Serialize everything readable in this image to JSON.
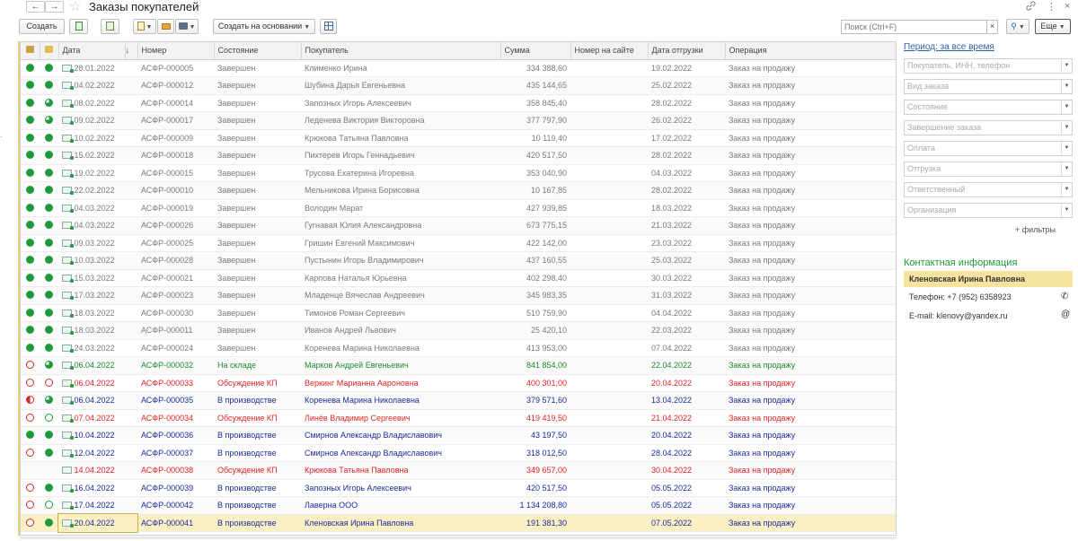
{
  "window": {
    "title": "Заказы покупателей",
    "back": "←",
    "forward": "→",
    "link_icon": "link-icon",
    "menu_icon": "⋮",
    "close_icon": "×"
  },
  "toolbar": {
    "create_label": "Создать",
    "create_basis_label": "Создать на основании",
    "search_placeholder": "Поиск (Ctrl+F)",
    "search_clear": "×",
    "search_btn": "🔍",
    "more_label": "Еще"
  },
  "table": {
    "columns": [
      "",
      "",
      "Дата",
      "↓",
      "Номер",
      "Состояние",
      "Покупатель",
      "Сумма",
      "Номер на сайте",
      "Дата отгрузки",
      "Операция"
    ],
    "rows": [
      {
        "ind1": "full",
        "ind2": "full",
        "date": "28.01.2022",
        "number": "АСФР-000005",
        "state": "Завершен",
        "customer": "Клименко Ирина",
        "sum": "334 388,60",
        "ship": "19.02.2022",
        "op": "Заказ на продажу",
        "style": "complete"
      },
      {
        "ind1": "full",
        "ind2": "full",
        "date": "04.02.2022",
        "number": "АСФР-000012",
        "state": "Завершен",
        "customer": "Шубина Дарья Евгеньевна",
        "sum": "435 144,65",
        "ship": "25.02.2022",
        "op": "Заказ на продажу",
        "style": "complete"
      },
      {
        "ind1": "full",
        "ind2": "part-green",
        "date": "08.02.2022",
        "number": "АСФР-000014",
        "state": "Завершен",
        "customer": "Запозных Игорь Алексеевич",
        "sum": "358 845,40",
        "ship": "28.02.2022",
        "op": "Заказ на продажу",
        "style": "complete"
      },
      {
        "ind1": "full",
        "ind2": "part-green",
        "date": "09.02.2022",
        "number": "АСФР-000017",
        "state": "Завершен",
        "customer": "Леденева Виктория Викторовна",
        "sum": "377 797,90",
        "ship": "26.02.2022",
        "op": "Заказ на продажу",
        "style": "complete"
      },
      {
        "ind1": "full",
        "ind2": "full",
        "date": "10.02.2022",
        "number": "АСФР-000009",
        "state": "Завершен",
        "customer": "Крюкова Татьяна Павловна",
        "sum": "10 119,40",
        "ship": "17.02.2022",
        "op": "Заказ на продажу",
        "style": "complete"
      },
      {
        "ind1": "full",
        "ind2": "full",
        "date": "15.02.2022",
        "number": "АСФР-000018",
        "state": "Завершен",
        "customer": "Пихтерев Игорь Геннадьевич",
        "sum": "420 517,50",
        "ship": "28.02.2022",
        "op": "Заказ на продажу",
        "style": "complete"
      },
      {
        "ind1": "full",
        "ind2": "full",
        "date": "19.02.2022",
        "number": "АСФР-000015",
        "state": "Завершен",
        "customer": "Трусова Екатерина Игоревна",
        "sum": "353 040,90",
        "ship": "04.03.2022",
        "op": "Заказ на продажу",
        "style": "complete"
      },
      {
        "ind1": "full",
        "ind2": "full",
        "date": "22.02.2022",
        "number": "АСФР-000010",
        "state": "Завершен",
        "customer": "Мельникова Ирина Борисовна",
        "sum": "10 167,85",
        "ship": "28.02.2022",
        "op": "Заказ на продажу",
        "style": "complete"
      },
      {
        "ind1": "full",
        "ind2": "full",
        "date": "04.03.2022",
        "number": "АСФР-000019",
        "state": "Завершен",
        "customer": "Володин Марат",
        "sum": "427 939,85",
        "ship": "18.03.2022",
        "op": "Заказ на продажу",
        "style": "complete"
      },
      {
        "ind1": "full",
        "ind2": "full",
        "date": "04.03.2022",
        "number": "АСФР-000026",
        "state": "Завершен",
        "customer": "Гугнавая Юлия Александровна",
        "sum": "673 775,15",
        "ship": "21.03.2022",
        "op": "Заказ на продажу",
        "style": "complete"
      },
      {
        "ind1": "full",
        "ind2": "full",
        "date": "09.03.2022",
        "number": "АСФР-000025",
        "state": "Завершен",
        "customer": "Гришин Евгений Максимович",
        "sum": "422 142,00",
        "ship": "23.03.2022",
        "op": "Заказ на продажу",
        "style": "complete"
      },
      {
        "ind1": "full",
        "ind2": "full",
        "date": "10.03.2022",
        "number": "АСФР-000028",
        "state": "Завершен",
        "customer": "Пустынин Игорь Владимирович",
        "sum": "437 160,55",
        "ship": "25.03.2022",
        "op": "Заказ на продажу",
        "style": "complete"
      },
      {
        "ind1": "full",
        "ind2": "full",
        "date": "15.03.2022",
        "number": "АСФР-000021",
        "state": "Завершен",
        "customer": "Карпова Наталья Юрьевна",
        "sum": "402 298,40",
        "ship": "30.03.2022",
        "op": "Заказ на продажу",
        "style": "complete"
      },
      {
        "ind1": "full",
        "ind2": "full",
        "date": "17.03.2022",
        "number": "АСФР-000023",
        "state": "Завершен",
        "customer": "Младенце Вячеслав Андреевич",
        "sum": "345 983,35",
        "ship": "31.03.2022",
        "op": "Заказ на продажу",
        "style": "complete"
      },
      {
        "ind1": "full",
        "ind2": "full",
        "date": "18.03.2022",
        "number": "АСФР-000030",
        "state": "Завершен",
        "customer": "Тимонов Роман Сергеевич",
        "sum": "510 759,90",
        "ship": "04.04.2022",
        "op": "Заказ на продажу",
        "style": "complete"
      },
      {
        "ind1": "full",
        "ind2": "full",
        "date": "18.03.2022",
        "number": "АСФР-000011",
        "state": "Завершен",
        "customer": "Иванов Андрей Львович",
        "sum": "25 420,10",
        "ship": "22.03.2022",
        "op": "Заказ на продажу",
        "style": "complete"
      },
      {
        "ind1": "full",
        "ind2": "full",
        "date": "24.03.2022",
        "number": "АСФР-000024",
        "state": "Завершен",
        "customer": "Коренева Марина Николаевна",
        "sum": "413 953,00",
        "ship": "07.04.2022",
        "op": "Заказ на продажу",
        "style": "complete"
      },
      {
        "ind1": "ring-red",
        "ind2": "part-green",
        "date": "06.04.2022",
        "number": "АСФР-000032",
        "state": "На складе",
        "customer": "Марков Андрей Евгеньевич",
        "sum": "841 854,00",
        "ship": "22.04.2022",
        "op": "Заказ на продажу",
        "style": "green"
      },
      {
        "ind1": "ring-red",
        "ind2": "ring-red",
        "date": "06.04.2022",
        "number": "АСФР-000033",
        "state": "Обсуждение КП",
        "customer": "Веркинг Марианна Аароновна",
        "sum": "400 301,00",
        "ship": "20.04.2022",
        "op": "Заказ на продажу",
        "style": "red"
      },
      {
        "ind1": "half-red",
        "ind2": "part-green",
        "date": "06.04.2022",
        "number": "АСФР-000035",
        "state": "В производстве",
        "customer": "Коренева Марина Николаевна",
        "sum": "379 571,60",
        "ship": "13.04.2022",
        "op": "Заказ на продажу",
        "style": "blue"
      },
      {
        "ind1": "ring-red",
        "ind2": "ring-green",
        "date": "07.04.2022",
        "number": "АСФР-000034",
        "state": "Обсуждение КП",
        "customer": "Линёв Владимир Сергеевич",
        "sum": "419 419,50",
        "ship": "21.04.2022",
        "op": "Заказ на продажу",
        "style": "red"
      },
      {
        "ind1": "full",
        "ind2": "full",
        "date": "10.04.2022",
        "number": "АСФР-000036",
        "state": "В производстве",
        "customer": "Смирнов Александр Владиславович",
        "sum": "43 197,50",
        "ship": "20.04.2022",
        "op": "Заказ на продажу",
        "style": "blue"
      },
      {
        "ind1": "ring-red",
        "ind2": "full",
        "date": "12.04.2022",
        "number": "АСФР-000037",
        "state": "В производстве",
        "customer": "Смирнов Александр Владиславович",
        "sum": "318 012,50",
        "ship": "28.04.2022",
        "op": "Заказ на продажу",
        "style": "blue"
      },
      {
        "ind1": "none",
        "ind2": "none",
        "date": "14.04.2022",
        "number": "АСФР-000038",
        "state": "Обсуждение КП",
        "customer": "Крюкова Татьяна Павловна",
        "sum": "349 657,00",
        "ship": "30.04.2022",
        "op": "Заказ на продажу",
        "style": "red"
      },
      {
        "ind1": "ring-red",
        "ind2": "full",
        "date": "16.04.2022",
        "number": "АСФР-000039",
        "state": "В производстве",
        "customer": "Запозных Игорь Алексеевич",
        "sum": "420 517,50",
        "ship": "05.05.2022",
        "op": "Заказ на продажу",
        "style": "blue"
      },
      {
        "ind1": "ring-red",
        "ind2": "ring-green",
        "date": "17.04.2022",
        "number": "АСФР-000042",
        "state": "В производстве",
        "customer": "Лаверна ООО",
        "sum": "1 134 208,80",
        "ship": "05.05.2022",
        "op": "Заказ на продажу",
        "style": "blue"
      },
      {
        "ind1": "ring-red",
        "ind2": "full",
        "date": "20.04.2022",
        "number": "АСФР-000041",
        "state": "В производстве",
        "customer": "Кленовская Ирина Павловна",
        "sum": "191 381,30",
        "ship": "07.05.2022",
        "op": "Заказ на продажу",
        "style": "blue",
        "selected": true
      }
    ]
  },
  "filters": {
    "period_label": "Период: за все время",
    "items": [
      "Покупатель, ИНН, телефон",
      "Вид заказа",
      "Состояние",
      "Завершение заказа",
      "Оплата",
      "Отгрузка",
      "Ответственный",
      "Организация"
    ],
    "more_label": "+ фильтры"
  },
  "contact": {
    "title": "Контактная информация",
    "name": "Кленовская Ирина Павловна",
    "phone": "Телефон: +7 (952) 6358923",
    "email": "E-mail: klenovy@yandex.ru"
  },
  "colors": {
    "complete": "#7a7a7a",
    "green": "#1d8a2a",
    "red": "#e02424",
    "blue": "#1b2c9c",
    "selected_row": "#fbefc4",
    "accent_green": "#1f9a3a"
  }
}
